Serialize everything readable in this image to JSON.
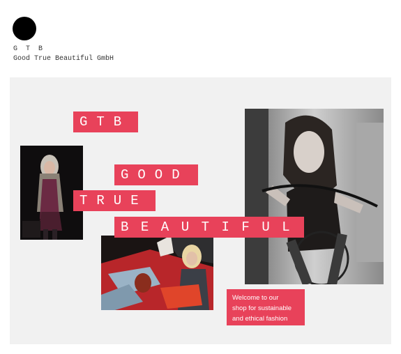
{
  "brand": {
    "short": "G T B",
    "full": "Good True Beautiful GmbH"
  },
  "tags": {
    "gtb": "GTB",
    "good": "GOOD",
    "true": "TRUE",
    "beautiful": "BEAUTIFUL"
  },
  "welcome": {
    "line1": "Welcome to our",
    "line2": "shop for sustainable",
    "line3": "and ethical fashion"
  },
  "colors": {
    "accent": "#e8425a",
    "stage": "#f1f1f1"
  }
}
